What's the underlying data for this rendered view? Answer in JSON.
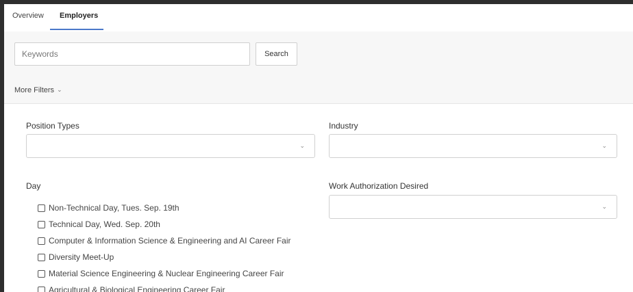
{
  "tabs": {
    "overview_label": "Overview",
    "employers_label": "Employers",
    "active": "Employers"
  },
  "search": {
    "placeholder": "Keywords",
    "value": "",
    "button_label": "Search"
  },
  "more_filters": {
    "label": "More Filters",
    "icon": "chevron-down-icon"
  },
  "filters": {
    "position_types": {
      "label": "Position Types",
      "selected": ""
    },
    "industry": {
      "label": "Industry",
      "selected": ""
    },
    "work_authorization": {
      "label": "Work Authorization Desired",
      "selected": ""
    },
    "day": {
      "label": "Day",
      "options": [
        {
          "label": "Non-Technical Day, Tues. Sep. 19th",
          "checked": false
        },
        {
          "label": "Technical Day, Wed. Sep. 20th",
          "checked": false
        },
        {
          "label": "Computer & Information Science & Engineering and AI Career Fair",
          "checked": false
        },
        {
          "label": "Diversity Meet-Up",
          "checked": false
        },
        {
          "label": "Material Science Engineering & Nuclear Engineering Career Fair",
          "checked": false
        },
        {
          "label": "Agricultural & Biological Engineering Career Fair",
          "checked": false
        }
      ]
    }
  },
  "colors": {
    "tab_underline": "#4a78c9",
    "background_outer": "#2e2e2e",
    "panel_bg": "#f7f7f7"
  }
}
